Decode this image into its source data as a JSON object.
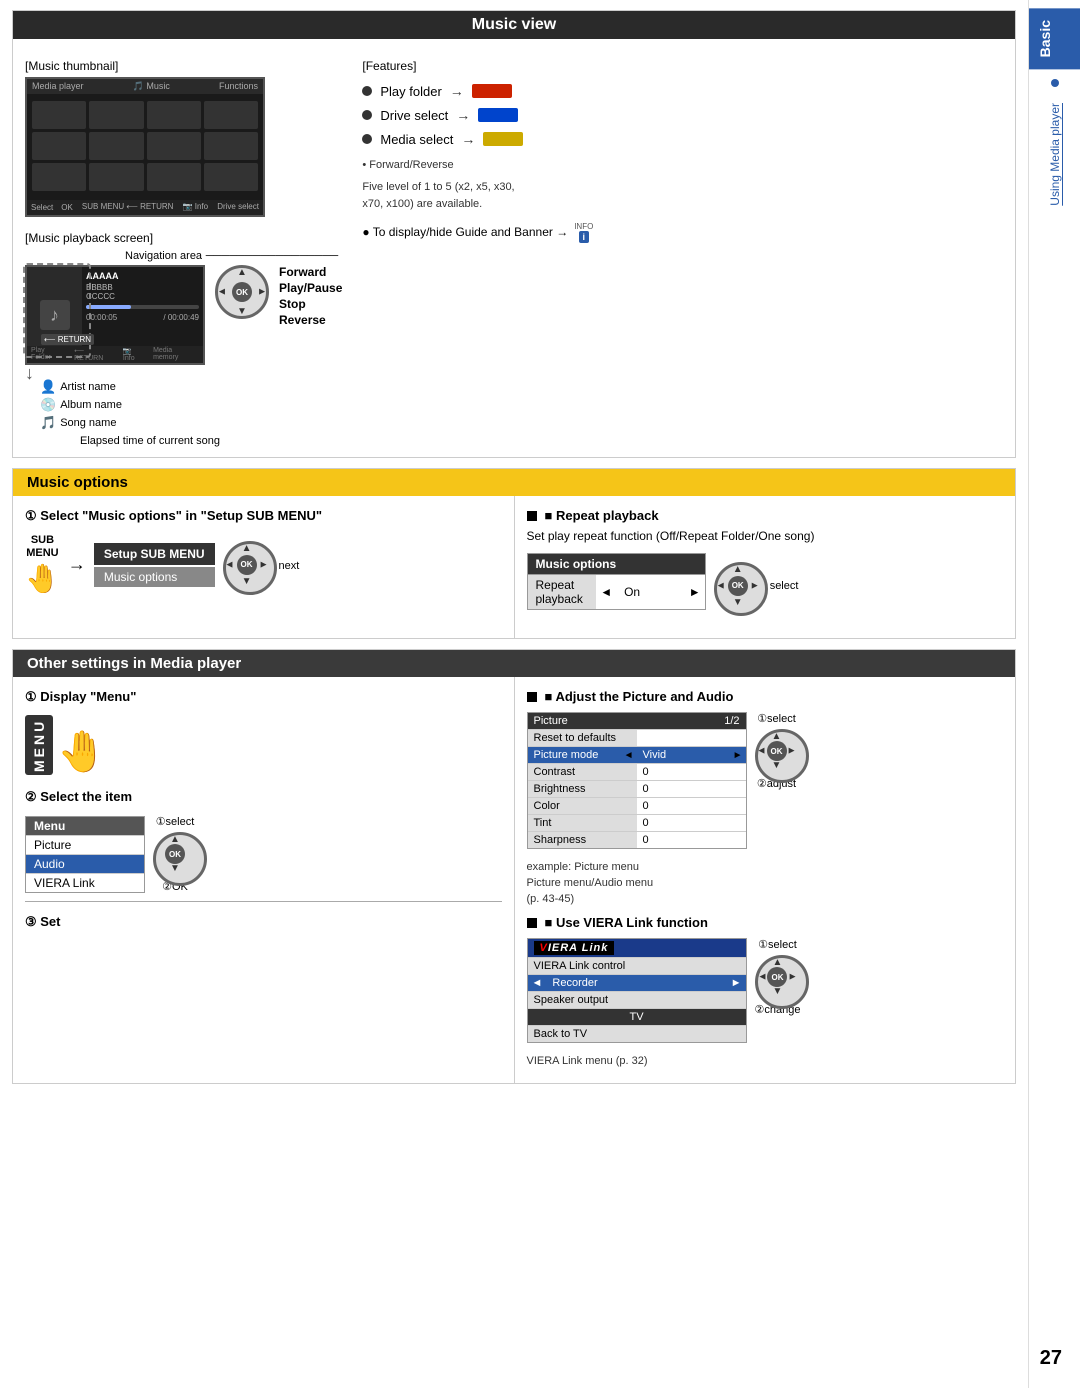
{
  "page": {
    "number": "27",
    "sidebar": {
      "basic_label": "Basic",
      "using_label": "Using Media player"
    }
  },
  "music_view": {
    "title": "Music view",
    "thumbnail_label": "[Music thumbnail]",
    "playback_label": "[Music playback screen]",
    "features_label": "[Features]",
    "features": [
      {
        "text": "Play folder",
        "btn_color": "red",
        "btn_class": "btn-red"
      },
      {
        "text": "Drive select",
        "btn_color": "blue",
        "btn_class": "btn-blue"
      },
      {
        "text": "Media select",
        "btn_color": "yellow",
        "btn_class": "btn-yellow"
      }
    ],
    "navigation_area": "Navigation area",
    "elapsed_time": "Elapsed time of current song",
    "forward_label": "Forward",
    "play_pause_label": "Play/Pause",
    "stop_label": "Stop",
    "reverse_label": "Reverse",
    "forward_reverse_note": "• Forward/Reverse\nFive level of 1 to 5 (x2, x5, x30,\nx70, x100) are available.",
    "guide_banner": "● To display/hide Guide and Banner →",
    "artist_name": "Artist name",
    "album_name": "Album name",
    "song_name": "Song name",
    "info_top": "INFO"
  },
  "music_options": {
    "title": "Music options",
    "step1_title": "① Select \"Music options\" in \"Setup SUB MENU\"",
    "sub_menu_label": "SUB\nMENU",
    "setup_sub_menu": "Setup SUB MENU",
    "music_options_item": "Music options",
    "next_label": "next",
    "repeat_title": "■ Repeat playback",
    "repeat_desc": "Set play repeat function (Off/Repeat Folder/One song)",
    "mot_header": "Music options",
    "mot_label": "Repeat playback",
    "mot_arrow_left": "◄",
    "mot_value": "On",
    "mot_arrow_right": "►",
    "select_label": "select"
  },
  "other_settings": {
    "title": "Other settings in Media player",
    "display_menu_title": "① Display \"Menu\"",
    "menu_text": "MENU",
    "select_item_title": "② Select the item",
    "select_label": "①select",
    "ok_label": "②OK",
    "set_title": "③ Set",
    "menu_items": [
      {
        "label": "Menu",
        "selected": false
      },
      {
        "label": "Picture",
        "selected": false
      },
      {
        "label": "Audio",
        "selected": true
      },
      {
        "label": "VIERA Link",
        "selected": false
      }
    ],
    "adjust_picture_title": "■ Adjust the Picture and Audio",
    "picture_header": "Picture",
    "picture_page": "1/2",
    "picture_rows": [
      {
        "label": "Reset to defaults",
        "value": ""
      },
      {
        "label": "Picture mode",
        "arrow_left": "◄",
        "value": "Vivid",
        "arrow_right": "►",
        "highlight": true
      },
      {
        "label": "Contrast",
        "value": "0"
      },
      {
        "label": "Brightness",
        "value": "0"
      },
      {
        "label": "Color",
        "value": "0"
      },
      {
        "label": "Tint",
        "value": "0"
      },
      {
        "label": "Sharpness",
        "value": "0"
      }
    ],
    "select_label_pic": "①select",
    "adjust_label_pic": "②adjust",
    "example_note": "example: Picture menu",
    "picture_audio_note": "Picture menu/Audio menu",
    "page_ref_note": "(p. 43-45)",
    "viera_link_title": "■ Use VIERA Link function",
    "viera_link_logo": "VIERA Link",
    "viera_link_rows": [
      {
        "label": "VIERA Link control",
        "value": ""
      },
      {
        "label": "",
        "value": "Recorder",
        "arrow_left": "◄",
        "arrow_right": "►",
        "highlight": true
      },
      {
        "label": "Speaker output",
        "value": ""
      },
      {
        "label": "",
        "value": "TV",
        "center": true
      },
      {
        "label": "Back to TV",
        "value": ""
      }
    ],
    "select_label_vl": "①select",
    "change_label_vl": "②change",
    "viera_menu_note": "VIERA Link menu (p. 32)"
  }
}
